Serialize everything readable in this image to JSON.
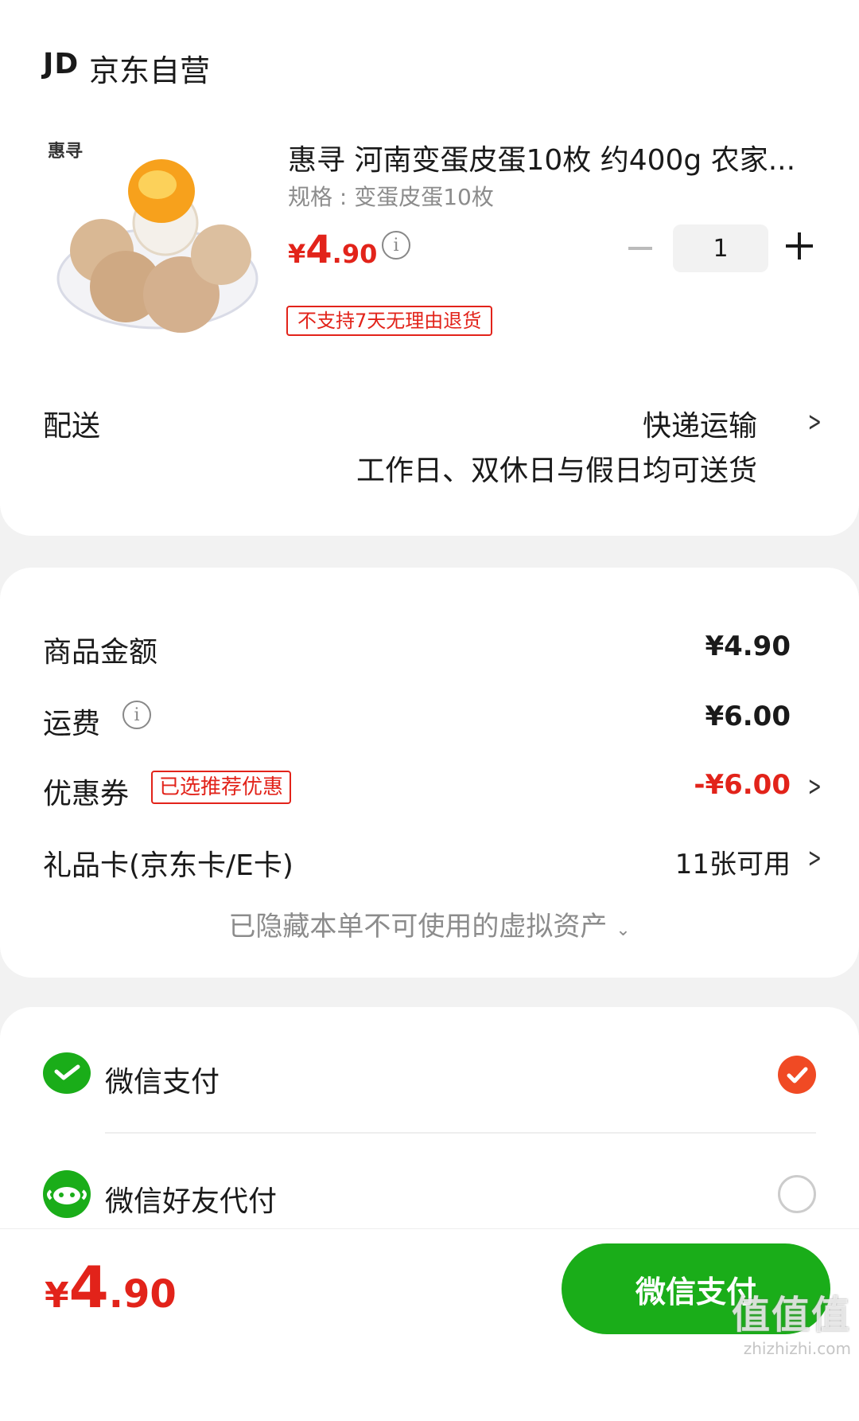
{
  "store": {
    "logo_text": "JD",
    "name": "京东自营"
  },
  "product": {
    "brand_logo_text": "惠寻",
    "title": "惠寻 河南变蛋皮蛋10枚 约400g 农家...",
    "spec": "规格 : 变蛋皮蛋10枚",
    "price_currency": "¥",
    "price_int": "4",
    "price_dec": ".90",
    "quantity": "1",
    "return_tag": "不支持7天无理由退货"
  },
  "delivery": {
    "label": "配送",
    "method": "快递运输",
    "note": "工作日、双休日与假日均可送货"
  },
  "amounts": {
    "goods_label": "商品金额",
    "goods_value": "¥4.90",
    "shipping_label": "运费",
    "shipping_value": "¥6.00",
    "coupon_label": "优惠券",
    "coupon_tag": "已选推荐优惠",
    "coupon_value": "-¥6.00",
    "giftcard_label": "礼品卡(京东卡/E卡)",
    "giftcard_value": "11张可用",
    "hidden_note": "已隐藏本单不可使用的虚拟资产"
  },
  "payment": {
    "options": [
      {
        "label": "微信支付",
        "selected": true
      },
      {
        "label": "微信好友代付",
        "selected": false
      }
    ]
  },
  "footer": {
    "total_currency": "¥",
    "total_int": "4",
    "total_dec": ".90",
    "pay_button": "微信支付",
    "watermark_big": "值值值",
    "watermark_small": "zhizhizhi.com"
  },
  "colors": {
    "accent_red": "#e2231a",
    "wechat_green": "#1aad19",
    "selected_orange": "#f04a24"
  }
}
